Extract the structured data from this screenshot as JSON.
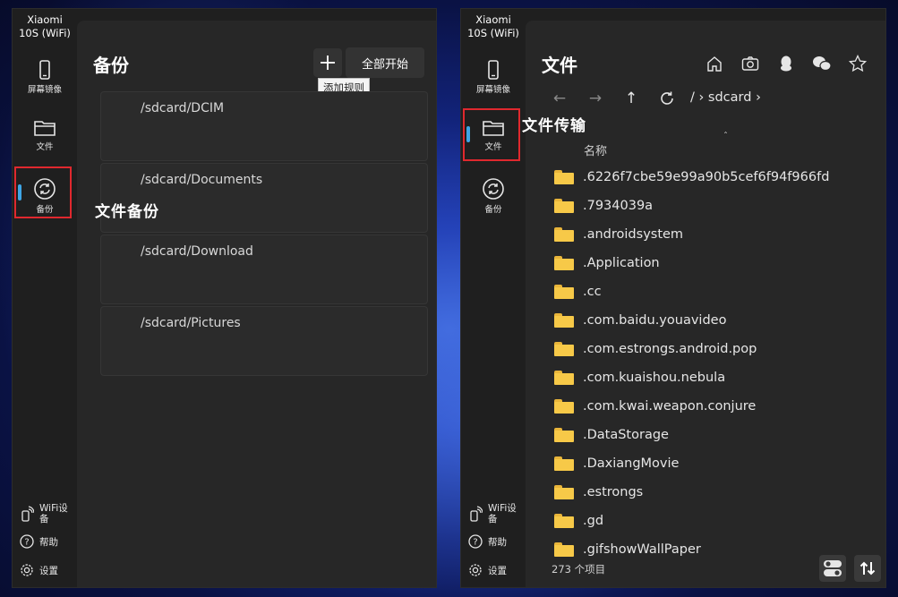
{
  "device": {
    "name_line1": "Xiaomi",
    "name_line2": "10S (WiFi)"
  },
  "nav": {
    "screen_mirror": "屏幕镜像",
    "files": "文件",
    "backup": "备份",
    "wifi_device": "WiFi设备",
    "help": "帮助",
    "settings": "设置"
  },
  "backup_page": {
    "title": "备份",
    "start_all_label": "全部开始",
    "add_rule_tooltip": "添加规则",
    "rules": [
      {
        "path": "/sdcard/DCIM"
      },
      {
        "path": "/sdcard/Documents"
      },
      {
        "path": "/sdcard/Download"
      },
      {
        "path": "/sdcard/Pictures"
      }
    ],
    "annotation": "文件备份"
  },
  "files_page": {
    "title": "文件",
    "annotation": "文件传输",
    "breadcrumb_root": "/",
    "breadcrumb_folder": "sdcard",
    "column_name": "名称",
    "item_count": "273 个项目",
    "files": [
      ".6226f7cbe59e99a90b5cef6f94f966fd",
      ".7934039a",
      ".androidsystem",
      ".Application",
      ".cc",
      ".com.baidu.youavideo",
      ".com.estrongs.android.pop",
      ".com.kuaishou.nebula",
      ".com.kwai.weapon.conjure",
      ".DataStorage",
      ".DaxiangMovie",
      ".estrongs",
      ".gd",
      ".gifshowWallPaper"
    ]
  },
  "colors": {
    "accent": "#3ea6e6",
    "highlight_box": "#e0282e",
    "folder": "#f7c948"
  }
}
